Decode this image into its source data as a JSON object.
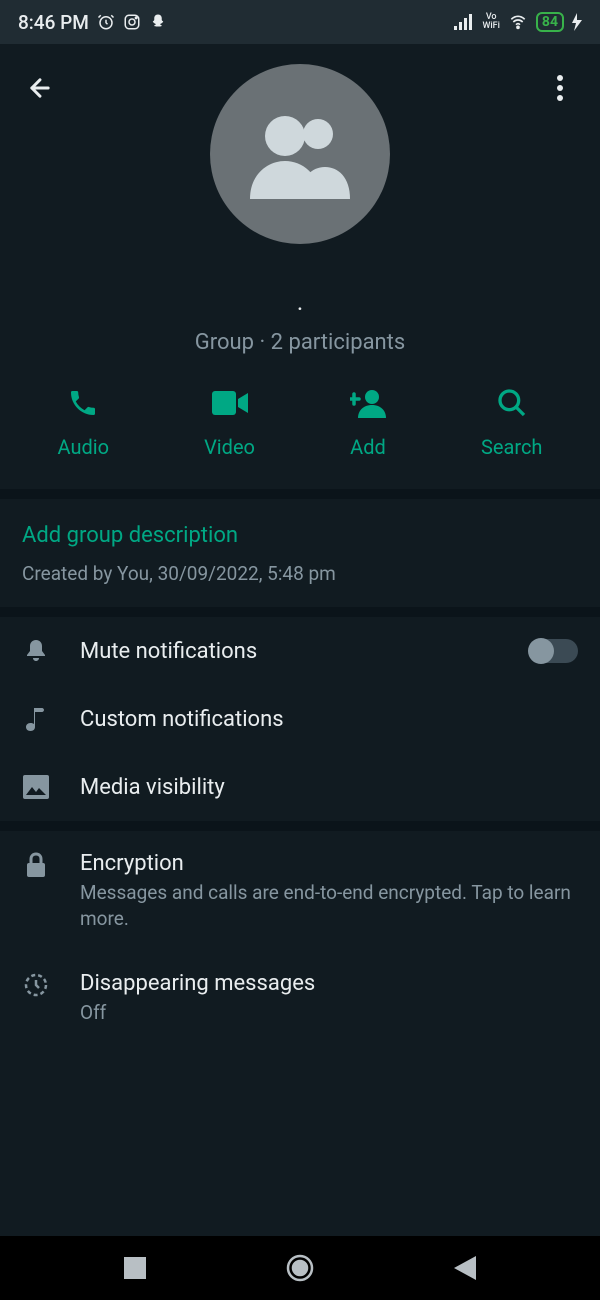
{
  "status": {
    "time": "8:46 PM",
    "battery": "84"
  },
  "header": {
    "group_name": ".",
    "subtitle": "Group · 2 participants"
  },
  "actions": {
    "audio": "Audio",
    "video": "Video",
    "add": "Add",
    "search": "Search"
  },
  "description": {
    "add_label": "Add group description",
    "created": "Created by You, 30/09/2022, 5:48 pm"
  },
  "settings": {
    "mute": "Mute notifications",
    "custom": "Custom notifications",
    "media": "Media visibility",
    "encryption_title": "Encryption",
    "encryption_sub": "Messages and calls are end-to-end encrypted. Tap to learn more.",
    "disappearing_title": "Disappearing messages",
    "disappearing_sub": "Off"
  },
  "colors": {
    "accent": "#00a884",
    "bg": "#111b21",
    "text_secondary": "#8696a0"
  }
}
